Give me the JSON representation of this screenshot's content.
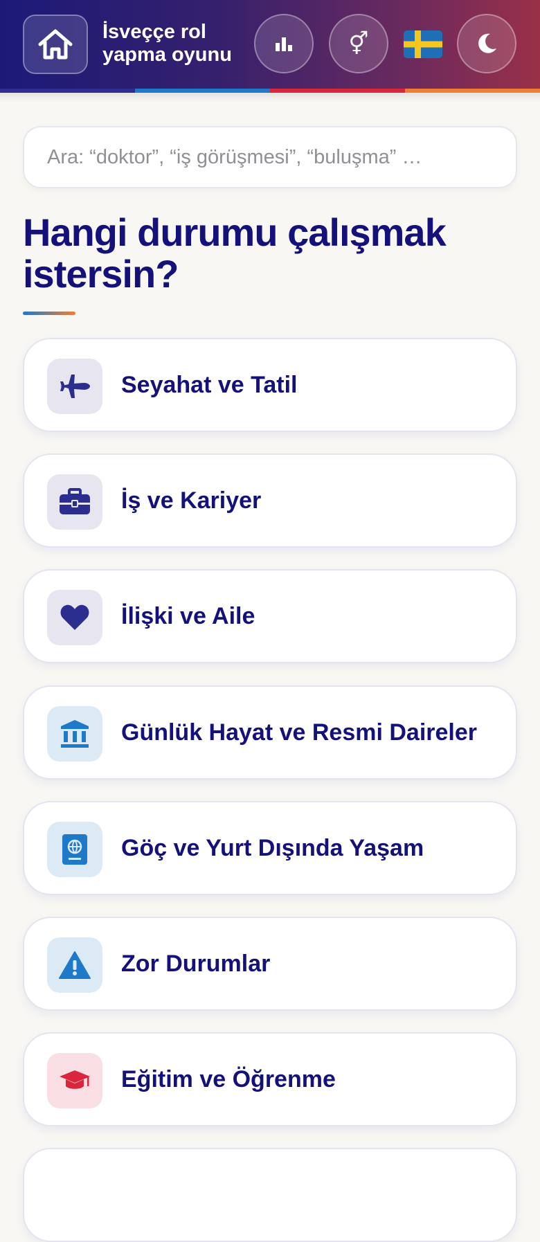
{
  "header": {
    "title": "İsveççe rol yapma oyunu",
    "flag": "🇸🇪",
    "icons": {
      "home": "home-icon",
      "stats": "bar-chart-icon",
      "gender": "gender-icon",
      "theme": "moon-icon"
    },
    "colors": {
      "stripe": [
        "#2c2e8f",
        "#1f79c9",
        "#d9263d",
        "#ec7f32"
      ]
    }
  },
  "search": {
    "placeholder": "Ara: “doktor”, “iş görüşmesi”, “buluşma” …",
    "value": ""
  },
  "main": {
    "heading": "Hangi durumu çalışmak istersin?",
    "categories": [
      {
        "label": "Seyahat ve Tatil",
        "icon": "airplane-icon",
        "color": "#2c2e8f"
      },
      {
        "label": "İş ve Kariyer",
        "icon": "briefcase-icon",
        "color": "#2c2e8f"
      },
      {
        "label": "İlişki ve Aile",
        "icon": "heart-icon",
        "color": "#2c2e8f"
      },
      {
        "label": "Günlük Hayat ve Resmi Daireler",
        "icon": "bank-icon",
        "color": "#1f79c9"
      },
      {
        "label": "Göç ve Yurt Dışında Yaşam",
        "icon": "passport-icon",
        "color": "#1f79c9"
      },
      {
        "label": "Zor Durumlar",
        "icon": "warning-icon",
        "color": "#1f79c9"
      },
      {
        "label": "Eğitim ve Öğrenme",
        "icon": "graduation-cap-icon",
        "color": "#d9263d"
      }
    ]
  }
}
